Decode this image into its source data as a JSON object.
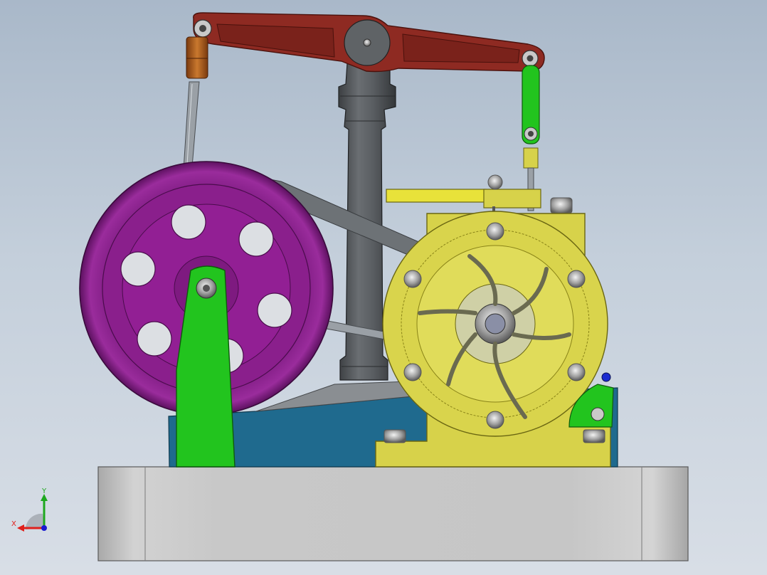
{
  "viewport": {
    "background_top": "#a9b8c9",
    "background_bottom": "#d8dee6"
  },
  "model": {
    "parts": [
      "base-plate",
      "frame",
      "column",
      "walking-beam",
      "flywheel",
      "flywheel-support",
      "cylinder-head",
      "connecting-rod",
      "piston-rod",
      "valve-linkage"
    ],
    "colors": {
      "base": "#c2c2c2",
      "frame": "#1f6a8e",
      "column": "#585c60",
      "beam": "#8e2a22",
      "flywheel": "#8a1f8c",
      "support": "#22c41e",
      "cylinder": "#d7d24a",
      "rod": "#8a8f96",
      "bronze": "#b5651d"
    }
  },
  "triad": {
    "x_label": "X",
    "y_label": "Y",
    "x_color": "#e0201b",
    "y_color": "#1ea81e",
    "z_color": "#1b1bd0"
  }
}
